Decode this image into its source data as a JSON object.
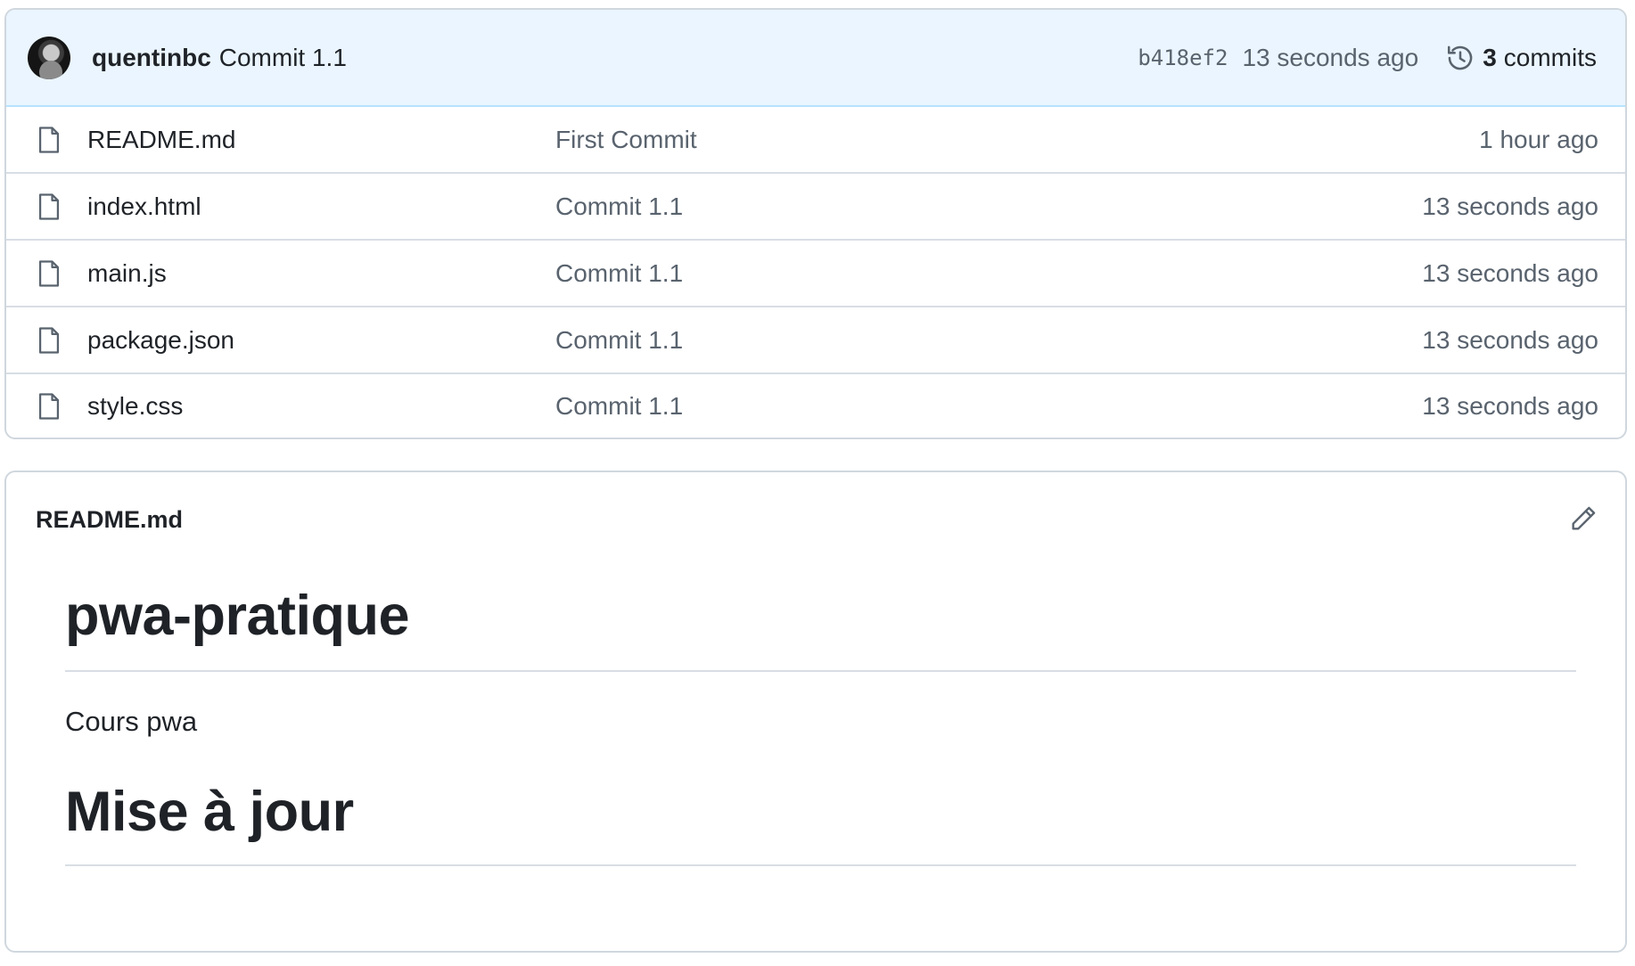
{
  "latest_commit": {
    "author": "quentinbc",
    "message": "Commit 1.1",
    "sha": "b418ef2",
    "time": "13 seconds ago",
    "commit_count": "3",
    "commit_count_label": "commits"
  },
  "files": [
    {
      "name": "README.md",
      "commit": "First Commit",
      "age": "1 hour ago",
      "icon": "file-icon"
    },
    {
      "name": "index.html",
      "commit": "Commit 1.1",
      "age": "13 seconds ago",
      "icon": "file-icon"
    },
    {
      "name": "main.js",
      "commit": "Commit 1.1",
      "age": "13 seconds ago",
      "icon": "file-icon"
    },
    {
      "name": "package.json",
      "commit": "Commit 1.1",
      "age": "13 seconds ago",
      "icon": "file-icon"
    },
    {
      "name": "style.css",
      "commit": "Commit 1.1",
      "age": "13 seconds ago",
      "icon": "file-icon"
    }
  ],
  "readme": {
    "filename": "README.md",
    "edit_icon": "pencil-icon",
    "h1": "pwa-pratique",
    "paragraph": "Cours pwa",
    "h1_second": "Mise à jour"
  },
  "colors": {
    "commit_bar_bg": "#eaf5ff",
    "border": "#d0d7de",
    "text": "#1f2328",
    "muted": "#59636e"
  }
}
